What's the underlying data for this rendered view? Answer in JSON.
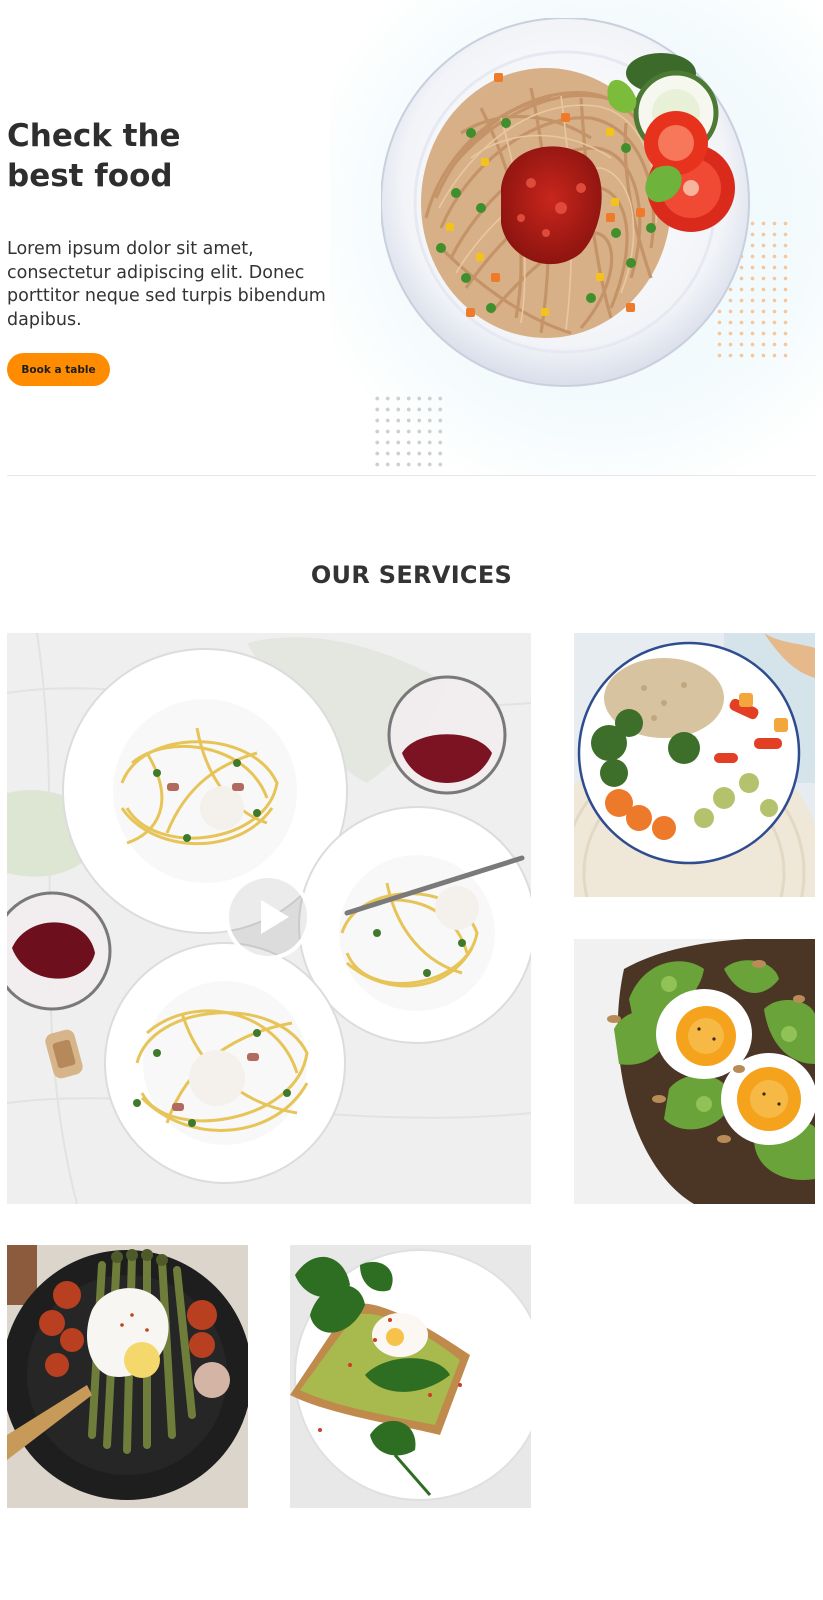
{
  "hero": {
    "title_line1": "Check the",
    "title_line2": "best food",
    "description": "Lorem ipsum dolor sit amet, consectetur adipiscing elit. Donec porttitor neque sed turpis bibendum dapibus.",
    "cta_label": "Book a table",
    "accent_color": "#ff8c00"
  },
  "services": {
    "title": "OUR SERVICES",
    "gallery": [
      {
        "name": "pasta-dinner-photo",
        "icon": "play-icon"
      },
      {
        "name": "grain-veggie-bowl-photo"
      },
      {
        "name": "avocado-egg-toast-photo"
      },
      {
        "name": "asparagus-poached-egg-photo"
      },
      {
        "name": "spinach-toast-photo"
      }
    ]
  }
}
